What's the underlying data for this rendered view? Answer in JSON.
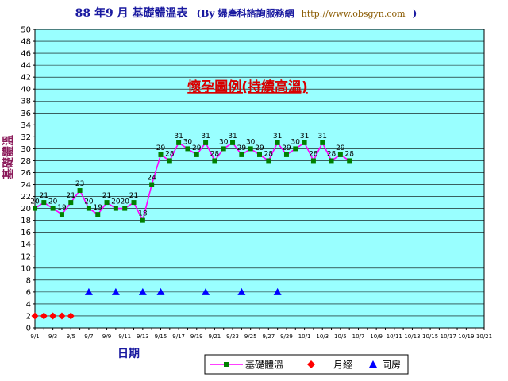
{
  "chart_data": {
    "type": "line",
    "title_main": "88 年9 月  基礎體溫表",
    "title_by": "(By 婦產科諮詢服務網",
    "title_url": "http://www.obsgyn.com",
    "title_end": ")",
    "ylabel": "基礎體溫",
    "xlabel": "日期",
    "annotation": "懷孕圖例(持續高溫)",
    "ylim": [
      0,
      50
    ],
    "yticks": [
      0,
      2,
      4,
      6,
      8,
      10,
      12,
      14,
      16,
      18,
      20,
      22,
      24,
      26,
      28,
      30,
      32,
      34,
      36,
      38,
      40,
      42,
      44,
      46,
      48,
      50
    ],
    "x_tick_labels": [
      "9/1",
      "9/3",
      "9/5",
      "9/7",
      "9/9",
      "9/11",
      "9/13",
      "9/15",
      "9/17",
      "9/19",
      "9/21",
      "9/23",
      "9/25",
      "9/27",
      "9/29",
      "10/1",
      "10/3",
      "10/5",
      "10/7",
      "10/9",
      "10/11",
      "10/13",
      "10/15",
      "10/17",
      "10/19",
      "10/21"
    ],
    "x_tick_step_days": 2,
    "n_days": 51,
    "grid": true,
    "legend_position": "bottom-right",
    "colors": {
      "plot_bg": "#99ffff",
      "temp_line": "#ff00ff",
      "temp_marker": "#008000",
      "menses": "#ff0000",
      "intercourse": "#0000ff",
      "annotation": "#d80000"
    },
    "series": [
      {
        "name": "基礎體溫",
        "values": [
          20,
          21,
          20,
          19,
          21,
          23,
          20,
          19,
          21,
          20,
          20,
          21,
          18,
          24,
          29,
          28,
          31,
          30,
          29,
          31,
          28,
          30,
          31,
          29,
          30,
          29,
          28,
          31,
          29,
          30,
          31,
          28,
          31,
          28,
          29,
          28
        ]
      },
      {
        "name": "月經",
        "x_days": [
          1,
          2,
          3,
          4,
          5
        ],
        "values": [
          2,
          2,
          2,
          2,
          2
        ]
      },
      {
        "name": "同房",
        "x_days": [
          7,
          10,
          13,
          15,
          20,
          24,
          28
        ],
        "values": [
          6,
          6,
          6,
          6,
          6,
          6,
          6
        ]
      }
    ]
  }
}
